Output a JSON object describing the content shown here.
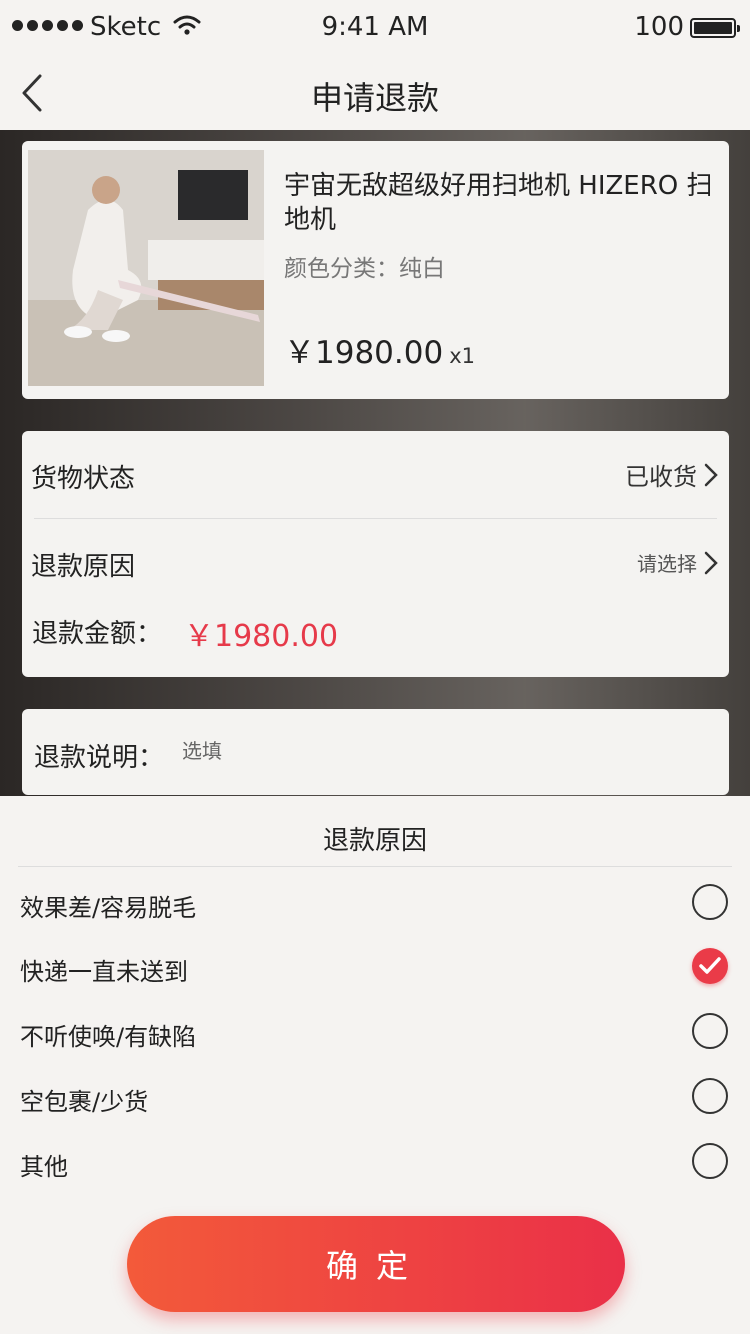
{
  "status_bar": {
    "carrier": "Sketc",
    "time": "9:41 AM",
    "battery": "100"
  },
  "nav": {
    "title": "申请退款",
    "back_icon": "chevron-left-icon"
  },
  "product": {
    "name": "宇宙无敌超级好用扫地机 HIZERO 扫地机",
    "variant_label": "颜色分类：",
    "variant_value": "纯白",
    "price": "￥1980.00",
    "quantity": "x1"
  },
  "refund": {
    "goods_status_label": "货物状态",
    "goods_status_value": "已收货",
    "reason_label": "退款原因",
    "reason_value": "请选择",
    "amount_label": "退款金额：",
    "amount_value": "￥1980.00",
    "amount_color": "#e63a4a"
  },
  "note": {
    "label": "退款说明：",
    "placeholder": "选填"
  },
  "reason_sheet": {
    "title": "退款原因",
    "options": [
      {
        "label": "效果差/容易脱毛",
        "checked": false
      },
      {
        "label": "快递一直未送到",
        "checked": true
      },
      {
        "label": "不听使唤/有缺陷",
        "checked": false
      },
      {
        "label": "空包裹/少货",
        "checked": false
      },
      {
        "label": "其他",
        "checked": false
      }
    ],
    "confirm_label": "确定",
    "accent_color": "#ea3b48"
  }
}
